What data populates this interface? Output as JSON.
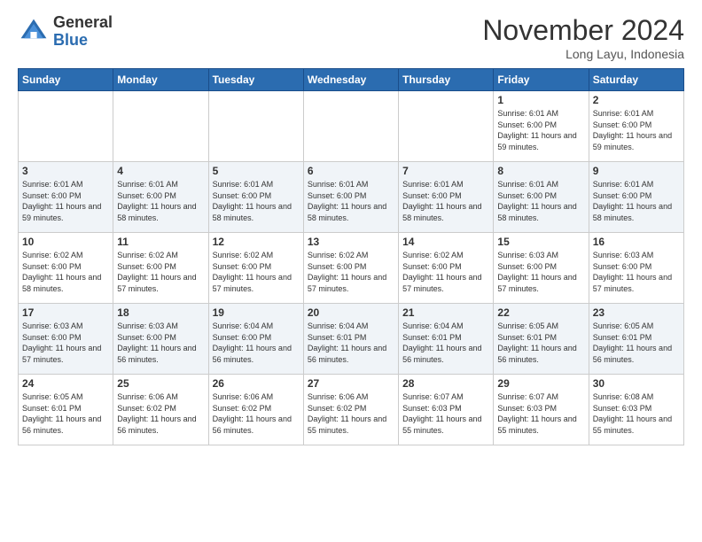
{
  "header": {
    "logo_line1": "General",
    "logo_line2": "Blue",
    "month_title": "November 2024",
    "location": "Long Layu, Indonesia"
  },
  "days_of_week": [
    "Sunday",
    "Monday",
    "Tuesday",
    "Wednesday",
    "Thursday",
    "Friday",
    "Saturday"
  ],
  "weeks": [
    [
      {
        "day": "",
        "info": ""
      },
      {
        "day": "",
        "info": ""
      },
      {
        "day": "",
        "info": ""
      },
      {
        "day": "",
        "info": ""
      },
      {
        "day": "",
        "info": ""
      },
      {
        "day": "1",
        "info": "Sunrise: 6:01 AM\nSunset: 6:00 PM\nDaylight: 11 hours and 59 minutes."
      },
      {
        "day": "2",
        "info": "Sunrise: 6:01 AM\nSunset: 6:00 PM\nDaylight: 11 hours and 59 minutes."
      }
    ],
    [
      {
        "day": "3",
        "info": "Sunrise: 6:01 AM\nSunset: 6:00 PM\nDaylight: 11 hours and 59 minutes."
      },
      {
        "day": "4",
        "info": "Sunrise: 6:01 AM\nSunset: 6:00 PM\nDaylight: 11 hours and 58 minutes."
      },
      {
        "day": "5",
        "info": "Sunrise: 6:01 AM\nSunset: 6:00 PM\nDaylight: 11 hours and 58 minutes."
      },
      {
        "day": "6",
        "info": "Sunrise: 6:01 AM\nSunset: 6:00 PM\nDaylight: 11 hours and 58 minutes."
      },
      {
        "day": "7",
        "info": "Sunrise: 6:01 AM\nSunset: 6:00 PM\nDaylight: 11 hours and 58 minutes."
      },
      {
        "day": "8",
        "info": "Sunrise: 6:01 AM\nSunset: 6:00 PM\nDaylight: 11 hours and 58 minutes."
      },
      {
        "day": "9",
        "info": "Sunrise: 6:01 AM\nSunset: 6:00 PM\nDaylight: 11 hours and 58 minutes."
      }
    ],
    [
      {
        "day": "10",
        "info": "Sunrise: 6:02 AM\nSunset: 6:00 PM\nDaylight: 11 hours and 58 minutes."
      },
      {
        "day": "11",
        "info": "Sunrise: 6:02 AM\nSunset: 6:00 PM\nDaylight: 11 hours and 57 minutes."
      },
      {
        "day": "12",
        "info": "Sunrise: 6:02 AM\nSunset: 6:00 PM\nDaylight: 11 hours and 57 minutes."
      },
      {
        "day": "13",
        "info": "Sunrise: 6:02 AM\nSunset: 6:00 PM\nDaylight: 11 hours and 57 minutes."
      },
      {
        "day": "14",
        "info": "Sunrise: 6:02 AM\nSunset: 6:00 PM\nDaylight: 11 hours and 57 minutes."
      },
      {
        "day": "15",
        "info": "Sunrise: 6:03 AM\nSunset: 6:00 PM\nDaylight: 11 hours and 57 minutes."
      },
      {
        "day": "16",
        "info": "Sunrise: 6:03 AM\nSunset: 6:00 PM\nDaylight: 11 hours and 57 minutes."
      }
    ],
    [
      {
        "day": "17",
        "info": "Sunrise: 6:03 AM\nSunset: 6:00 PM\nDaylight: 11 hours and 57 minutes."
      },
      {
        "day": "18",
        "info": "Sunrise: 6:03 AM\nSunset: 6:00 PM\nDaylight: 11 hours and 56 minutes."
      },
      {
        "day": "19",
        "info": "Sunrise: 6:04 AM\nSunset: 6:00 PM\nDaylight: 11 hours and 56 minutes."
      },
      {
        "day": "20",
        "info": "Sunrise: 6:04 AM\nSunset: 6:01 PM\nDaylight: 11 hours and 56 minutes."
      },
      {
        "day": "21",
        "info": "Sunrise: 6:04 AM\nSunset: 6:01 PM\nDaylight: 11 hours and 56 minutes."
      },
      {
        "day": "22",
        "info": "Sunrise: 6:05 AM\nSunset: 6:01 PM\nDaylight: 11 hours and 56 minutes."
      },
      {
        "day": "23",
        "info": "Sunrise: 6:05 AM\nSunset: 6:01 PM\nDaylight: 11 hours and 56 minutes."
      }
    ],
    [
      {
        "day": "24",
        "info": "Sunrise: 6:05 AM\nSunset: 6:01 PM\nDaylight: 11 hours and 56 minutes."
      },
      {
        "day": "25",
        "info": "Sunrise: 6:06 AM\nSunset: 6:02 PM\nDaylight: 11 hours and 56 minutes."
      },
      {
        "day": "26",
        "info": "Sunrise: 6:06 AM\nSunset: 6:02 PM\nDaylight: 11 hours and 56 minutes."
      },
      {
        "day": "27",
        "info": "Sunrise: 6:06 AM\nSunset: 6:02 PM\nDaylight: 11 hours and 55 minutes."
      },
      {
        "day": "28",
        "info": "Sunrise: 6:07 AM\nSunset: 6:03 PM\nDaylight: 11 hours and 55 minutes."
      },
      {
        "day": "29",
        "info": "Sunrise: 6:07 AM\nSunset: 6:03 PM\nDaylight: 11 hours and 55 minutes."
      },
      {
        "day": "30",
        "info": "Sunrise: 6:08 AM\nSunset: 6:03 PM\nDaylight: 11 hours and 55 minutes."
      }
    ]
  ]
}
